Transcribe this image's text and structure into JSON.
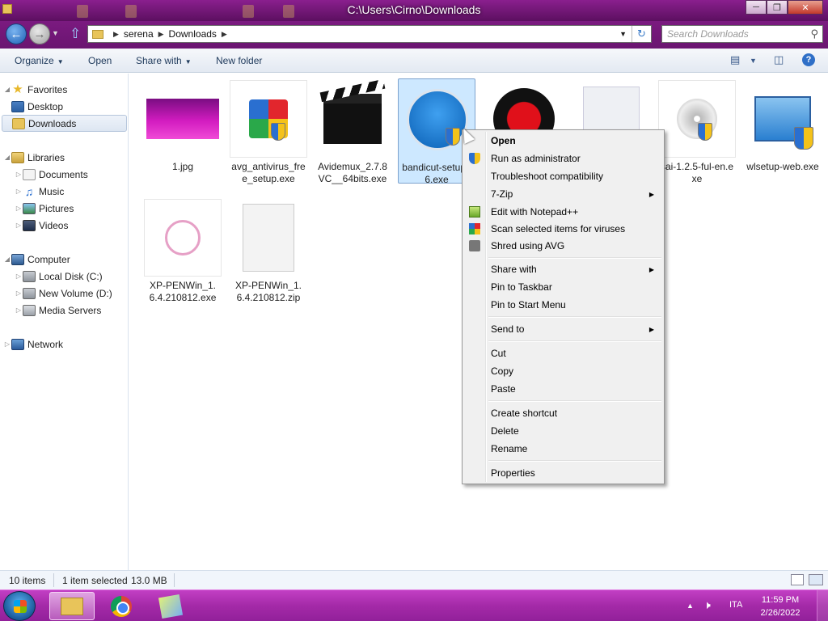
{
  "window": {
    "title": "C:\\Users\\Cirno\\Downloads"
  },
  "address": {
    "crumbs": [
      "serena",
      "Downloads"
    ]
  },
  "search": {
    "placeholder": "Search Downloads"
  },
  "toolbar": {
    "organize": "Organize",
    "open": "Open",
    "share_with": "Share with",
    "new_folder": "New folder"
  },
  "nav": {
    "favorites": "Favorites",
    "desktop": "Desktop",
    "downloads": "Downloads",
    "libraries": "Libraries",
    "documents": "Documents",
    "music": "Music",
    "pictures": "Pictures",
    "videos": "Videos",
    "computer": "Computer",
    "local_disk": "Local Disk (C:)",
    "new_volume": "New Volume (D:)",
    "media_servers": "Media Servers",
    "network": "Network"
  },
  "files": [
    {
      "name": "1.jpg"
    },
    {
      "name": "avg_antivirus_free_setup.exe"
    },
    {
      "name": "Avidemux_2.7.8VC__64bits.exe"
    },
    {
      "name": "bandicut-setup86.exe"
    },
    {
      "name": ""
    },
    {
      "name": ""
    },
    {
      "name": "sai-1.2.5-ful-en.exe"
    },
    {
      "name": "wlsetup-web.exe"
    },
    {
      "name": "XP-PENWin_1.6.4.210812.exe"
    },
    {
      "name": "XP-PENWin_1.6.4.210812.zip"
    }
  ],
  "context_menu": {
    "open": "Open",
    "run_as_admin": "Run as administrator",
    "troubleshoot": "Troubleshoot compatibility",
    "seven_zip": "7-Zip",
    "notepadpp": "Edit with Notepad++",
    "scan": "Scan selected items for viruses",
    "shred": "Shred using AVG",
    "share_with": "Share with",
    "pin_taskbar": "Pin to Taskbar",
    "pin_start": "Pin to Start Menu",
    "send_to": "Send to",
    "cut": "Cut",
    "copy": "Copy",
    "paste": "Paste",
    "create_shortcut": "Create shortcut",
    "delete": "Delete",
    "rename": "Rename",
    "properties": "Properties"
  },
  "status": {
    "item_count": "10 items",
    "selection": "1 item selected",
    "size": "13.0 MB"
  },
  "taskbar": {
    "language": "ITA",
    "time": "11:59 PM",
    "date": "2/26/2022"
  }
}
